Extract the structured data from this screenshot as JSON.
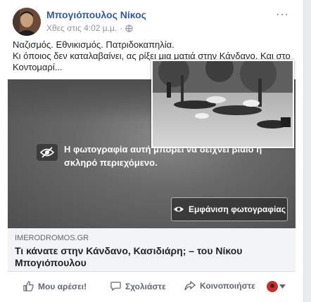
{
  "post": {
    "author": "Μπογιόπουλος Νίκος",
    "timestamp": "Χθες στις 4:02 μ.μ.",
    "separator": "·",
    "more": "···",
    "text_lines": [
      "Ναζισμός. Εθνικισμός. Πατριδοκαπηλία.",
      "Κι όποιος δεν καταλαβαίνει, ας ρίξει μια ματιά στην Κάνδανο. Και στο",
      "Κοντομαρί..."
    ]
  },
  "media": {
    "warning": "Η φωτογραφία αυτή μπορεί να δείχνει βίαιο ή σκληρό περιεχόμενο.",
    "show_button": "Εμφάνιση φωτογραφίας"
  },
  "link": {
    "domain": "IMERODROMOS.GR",
    "title": "Τι κάνατε στην Κάνδανο, Κασιδιάρη; – του Νίκου Μπογιόπουλου"
  },
  "actions": {
    "like": "Μου αρέσει!",
    "comment": "Σχολιάστε",
    "share": "Κοινοποιήστε"
  },
  "colors": {
    "author": "#365899",
    "icon": "#606770"
  }
}
